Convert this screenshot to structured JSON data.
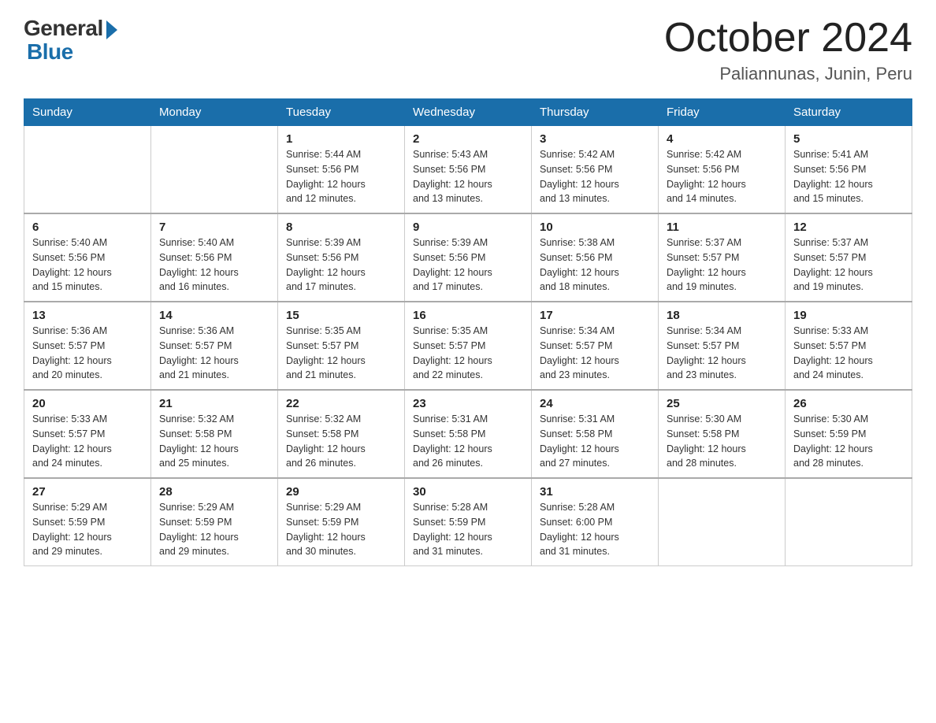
{
  "logo": {
    "general": "General",
    "blue": "Blue",
    "arrow": "▶"
  },
  "title": "October 2024",
  "subtitle": "Paliannunas, Junin, Peru",
  "header_days": [
    "Sunday",
    "Monday",
    "Tuesday",
    "Wednesday",
    "Thursday",
    "Friday",
    "Saturday"
  ],
  "weeks": [
    [
      {
        "day": "",
        "info": ""
      },
      {
        "day": "",
        "info": ""
      },
      {
        "day": "1",
        "info": "Sunrise: 5:44 AM\nSunset: 5:56 PM\nDaylight: 12 hours\nand 12 minutes."
      },
      {
        "day": "2",
        "info": "Sunrise: 5:43 AM\nSunset: 5:56 PM\nDaylight: 12 hours\nand 13 minutes."
      },
      {
        "day": "3",
        "info": "Sunrise: 5:42 AM\nSunset: 5:56 PM\nDaylight: 12 hours\nand 13 minutes."
      },
      {
        "day": "4",
        "info": "Sunrise: 5:42 AM\nSunset: 5:56 PM\nDaylight: 12 hours\nand 14 minutes."
      },
      {
        "day": "5",
        "info": "Sunrise: 5:41 AM\nSunset: 5:56 PM\nDaylight: 12 hours\nand 15 minutes."
      }
    ],
    [
      {
        "day": "6",
        "info": "Sunrise: 5:40 AM\nSunset: 5:56 PM\nDaylight: 12 hours\nand 15 minutes."
      },
      {
        "day": "7",
        "info": "Sunrise: 5:40 AM\nSunset: 5:56 PM\nDaylight: 12 hours\nand 16 minutes."
      },
      {
        "day": "8",
        "info": "Sunrise: 5:39 AM\nSunset: 5:56 PM\nDaylight: 12 hours\nand 17 minutes."
      },
      {
        "day": "9",
        "info": "Sunrise: 5:39 AM\nSunset: 5:56 PM\nDaylight: 12 hours\nand 17 minutes."
      },
      {
        "day": "10",
        "info": "Sunrise: 5:38 AM\nSunset: 5:56 PM\nDaylight: 12 hours\nand 18 minutes."
      },
      {
        "day": "11",
        "info": "Sunrise: 5:37 AM\nSunset: 5:57 PM\nDaylight: 12 hours\nand 19 minutes."
      },
      {
        "day": "12",
        "info": "Sunrise: 5:37 AM\nSunset: 5:57 PM\nDaylight: 12 hours\nand 19 minutes."
      }
    ],
    [
      {
        "day": "13",
        "info": "Sunrise: 5:36 AM\nSunset: 5:57 PM\nDaylight: 12 hours\nand 20 minutes."
      },
      {
        "day": "14",
        "info": "Sunrise: 5:36 AM\nSunset: 5:57 PM\nDaylight: 12 hours\nand 21 minutes."
      },
      {
        "day": "15",
        "info": "Sunrise: 5:35 AM\nSunset: 5:57 PM\nDaylight: 12 hours\nand 21 minutes."
      },
      {
        "day": "16",
        "info": "Sunrise: 5:35 AM\nSunset: 5:57 PM\nDaylight: 12 hours\nand 22 minutes."
      },
      {
        "day": "17",
        "info": "Sunrise: 5:34 AM\nSunset: 5:57 PM\nDaylight: 12 hours\nand 23 minutes."
      },
      {
        "day": "18",
        "info": "Sunrise: 5:34 AM\nSunset: 5:57 PM\nDaylight: 12 hours\nand 23 minutes."
      },
      {
        "day": "19",
        "info": "Sunrise: 5:33 AM\nSunset: 5:57 PM\nDaylight: 12 hours\nand 24 minutes."
      }
    ],
    [
      {
        "day": "20",
        "info": "Sunrise: 5:33 AM\nSunset: 5:57 PM\nDaylight: 12 hours\nand 24 minutes."
      },
      {
        "day": "21",
        "info": "Sunrise: 5:32 AM\nSunset: 5:58 PM\nDaylight: 12 hours\nand 25 minutes."
      },
      {
        "day": "22",
        "info": "Sunrise: 5:32 AM\nSunset: 5:58 PM\nDaylight: 12 hours\nand 26 minutes."
      },
      {
        "day": "23",
        "info": "Sunrise: 5:31 AM\nSunset: 5:58 PM\nDaylight: 12 hours\nand 26 minutes."
      },
      {
        "day": "24",
        "info": "Sunrise: 5:31 AM\nSunset: 5:58 PM\nDaylight: 12 hours\nand 27 minutes."
      },
      {
        "day": "25",
        "info": "Sunrise: 5:30 AM\nSunset: 5:58 PM\nDaylight: 12 hours\nand 28 minutes."
      },
      {
        "day": "26",
        "info": "Sunrise: 5:30 AM\nSunset: 5:59 PM\nDaylight: 12 hours\nand 28 minutes."
      }
    ],
    [
      {
        "day": "27",
        "info": "Sunrise: 5:29 AM\nSunset: 5:59 PM\nDaylight: 12 hours\nand 29 minutes."
      },
      {
        "day": "28",
        "info": "Sunrise: 5:29 AM\nSunset: 5:59 PM\nDaylight: 12 hours\nand 29 minutes."
      },
      {
        "day": "29",
        "info": "Sunrise: 5:29 AM\nSunset: 5:59 PM\nDaylight: 12 hours\nand 30 minutes."
      },
      {
        "day": "30",
        "info": "Sunrise: 5:28 AM\nSunset: 5:59 PM\nDaylight: 12 hours\nand 31 minutes."
      },
      {
        "day": "31",
        "info": "Sunrise: 5:28 AM\nSunset: 6:00 PM\nDaylight: 12 hours\nand 31 minutes."
      },
      {
        "day": "",
        "info": ""
      },
      {
        "day": "",
        "info": ""
      }
    ]
  ]
}
